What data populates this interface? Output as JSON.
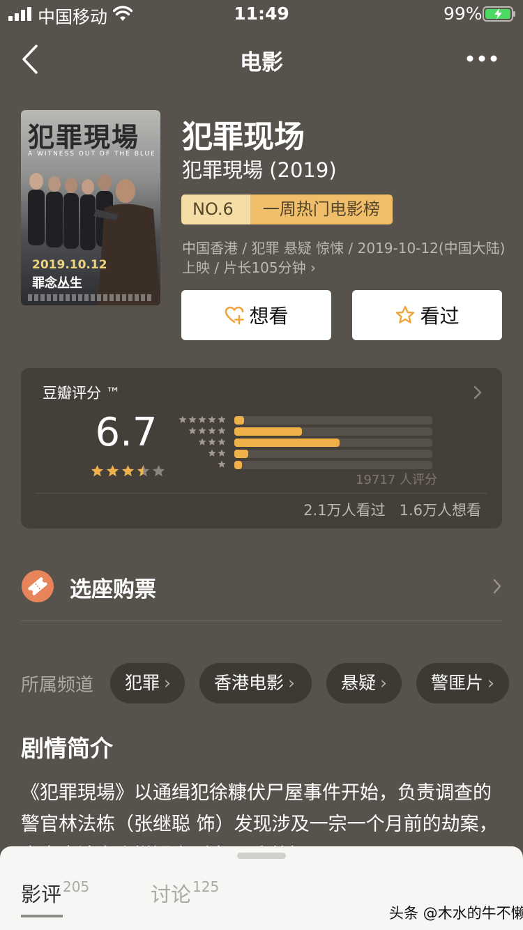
{
  "status_bar": {
    "carrier": "中国移动",
    "time": "11:49",
    "battery": "99%"
  },
  "nav": {
    "title": "电影"
  },
  "movie": {
    "title": "犯罪现场",
    "original_title": "犯罪現場 (2019)",
    "rank_no": "NO.6",
    "rank_list": "一周热门电影榜",
    "meta": "中国香港 / 犯罪 悬疑 惊悚 / 2019-10-12(中国大陆) 上映 / 片长105分钟",
    "meta_arrow": "›",
    "poster": {
      "title": "犯罪現場",
      "en_title": "A WITNESS OUT OF THE BLUE",
      "date": "2019.10.12",
      "tagline": "罪念丛生"
    }
  },
  "actions": {
    "want": "想看",
    "seen": "看过"
  },
  "rating": {
    "label": "豆瓣评分 ™",
    "score": "6.7",
    "stars": 3.5,
    "distribution": [
      {
        "stars": 5,
        "fraction": 0.05
      },
      {
        "stars": 4,
        "fraction": 0.34
      },
      {
        "stars": 3,
        "fraction": 0.53
      },
      {
        "stars": 2,
        "fraction": 0.07
      },
      {
        "stars": 1,
        "fraction": 0.04
      }
    ],
    "count": "19717 人评分",
    "watched": "2.1万人看过",
    "want": "1.6万人想看"
  },
  "tickets": {
    "label": "选座购票"
  },
  "channels": {
    "label": "所属频道",
    "items": [
      "犯罪",
      "香港电影",
      "悬疑",
      "警匪片"
    ],
    "arrow": "›"
  },
  "synopsis": {
    "title": "剧情简介",
    "text": "《犯罪現場》以通缉犯徐糠伏尸屋事件开始，负责调查的警官林法栋（张继聪 饰）发现涉及一宗一个月前的劫案，当中牵涉多个嫌疑人（古天乐 饰）"
  },
  "bottom_tabs": {
    "review": "影评",
    "review_count": "205",
    "discussion": "讨论",
    "discussion_count": "125",
    "watermark": "头条 @木水的牛不懒"
  },
  "colors": {
    "background": "#57524b",
    "card": "#443f39",
    "accent": "#f0b14a",
    "rank_light": "#f5dea6",
    "rank_dark": "#f0be6a",
    "ticket_icon": "#e8845a"
  }
}
